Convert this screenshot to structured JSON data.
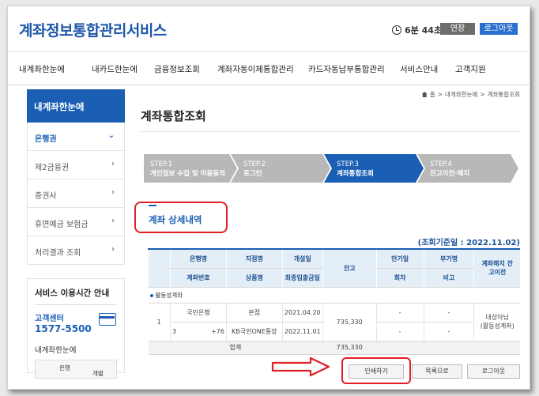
{
  "header": {
    "title": "계좌정보통합관리서비스",
    "timer": "6분 44초",
    "extend_label": "연장",
    "logout_label": "로그아웃"
  },
  "gnb": [
    "내계좌한눈에",
    "내카드한눈에",
    "금융정보조회",
    "계좌자동이체통합관리",
    "카드자동납부통합관리",
    "서비스안내",
    "고객지원"
  ],
  "sidebar": {
    "head": "내계좌한눈에",
    "items": [
      {
        "label": "은행권",
        "active": true
      },
      {
        "label": "제2금융권"
      },
      {
        "label": "증권사"
      },
      {
        "label": "휴면예금 보험금"
      },
      {
        "label": "처리결과 조회"
      }
    ],
    "service": {
      "title": "서비스 이용시간 안내",
      "center_label": "고객센터",
      "phone": "1577-5500",
      "sub_title": "내계좌한눈에",
      "mini_cols": [
        "은행",
        "개별"
      ]
    }
  },
  "main": {
    "breadcrumb": [
      "홈",
      "내계좌한눈에",
      "계좌통합조회"
    ],
    "page_title": "계좌통합조회",
    "steps": [
      {
        "no": "STEP.1",
        "label": "개인정보 수집 및 이용동의",
        "color": "#b8b8b8"
      },
      {
        "no": "STEP.2",
        "label": "로그인",
        "color": "#b8b8b8"
      },
      {
        "no": "STEP.3",
        "label": "계좌통합조회",
        "color": "#1a5fb4"
      },
      {
        "no": "STEP.4",
        "label": "잔고이전·해지",
        "color": "#b8b8b8"
      }
    ],
    "section_title": "계좌 상세내역",
    "date_note": "(조회기준일 : 2022.11.02)",
    "table": {
      "headers_top": [
        "은행명",
        "지점명",
        "개설일",
        "잔고",
        "만기일",
        "부기명",
        "계좌해지 잔고이전"
      ],
      "headers_bottom": [
        "계좌번호",
        "상품명",
        "최종입출금일",
        "회차",
        "비고"
      ],
      "group_label": "활동성계좌",
      "row": {
        "index": "1",
        "bank": "국민은행",
        "account_prefix": "3",
        "account_suffix": "+76",
        "branch": "본점",
        "product": "KB국민ONE통장",
        "opened": "2021.04.20",
        "last_tx": "2022.11.01",
        "balance": "735,330",
        "maturity": "-",
        "round": "-",
        "note1": "-",
        "note2": "-",
        "status_line1": "대상아님",
        "status_line2": "(활동성계좌)"
      },
      "total_label": "합계",
      "total_value": "735,330"
    },
    "buttons": {
      "print": "인쇄하기",
      "list": "목록으로",
      "logout": "로그아웃"
    }
  },
  "colors": {
    "brand": "#1a5fb4",
    "highlight": "#e01e26"
  }
}
